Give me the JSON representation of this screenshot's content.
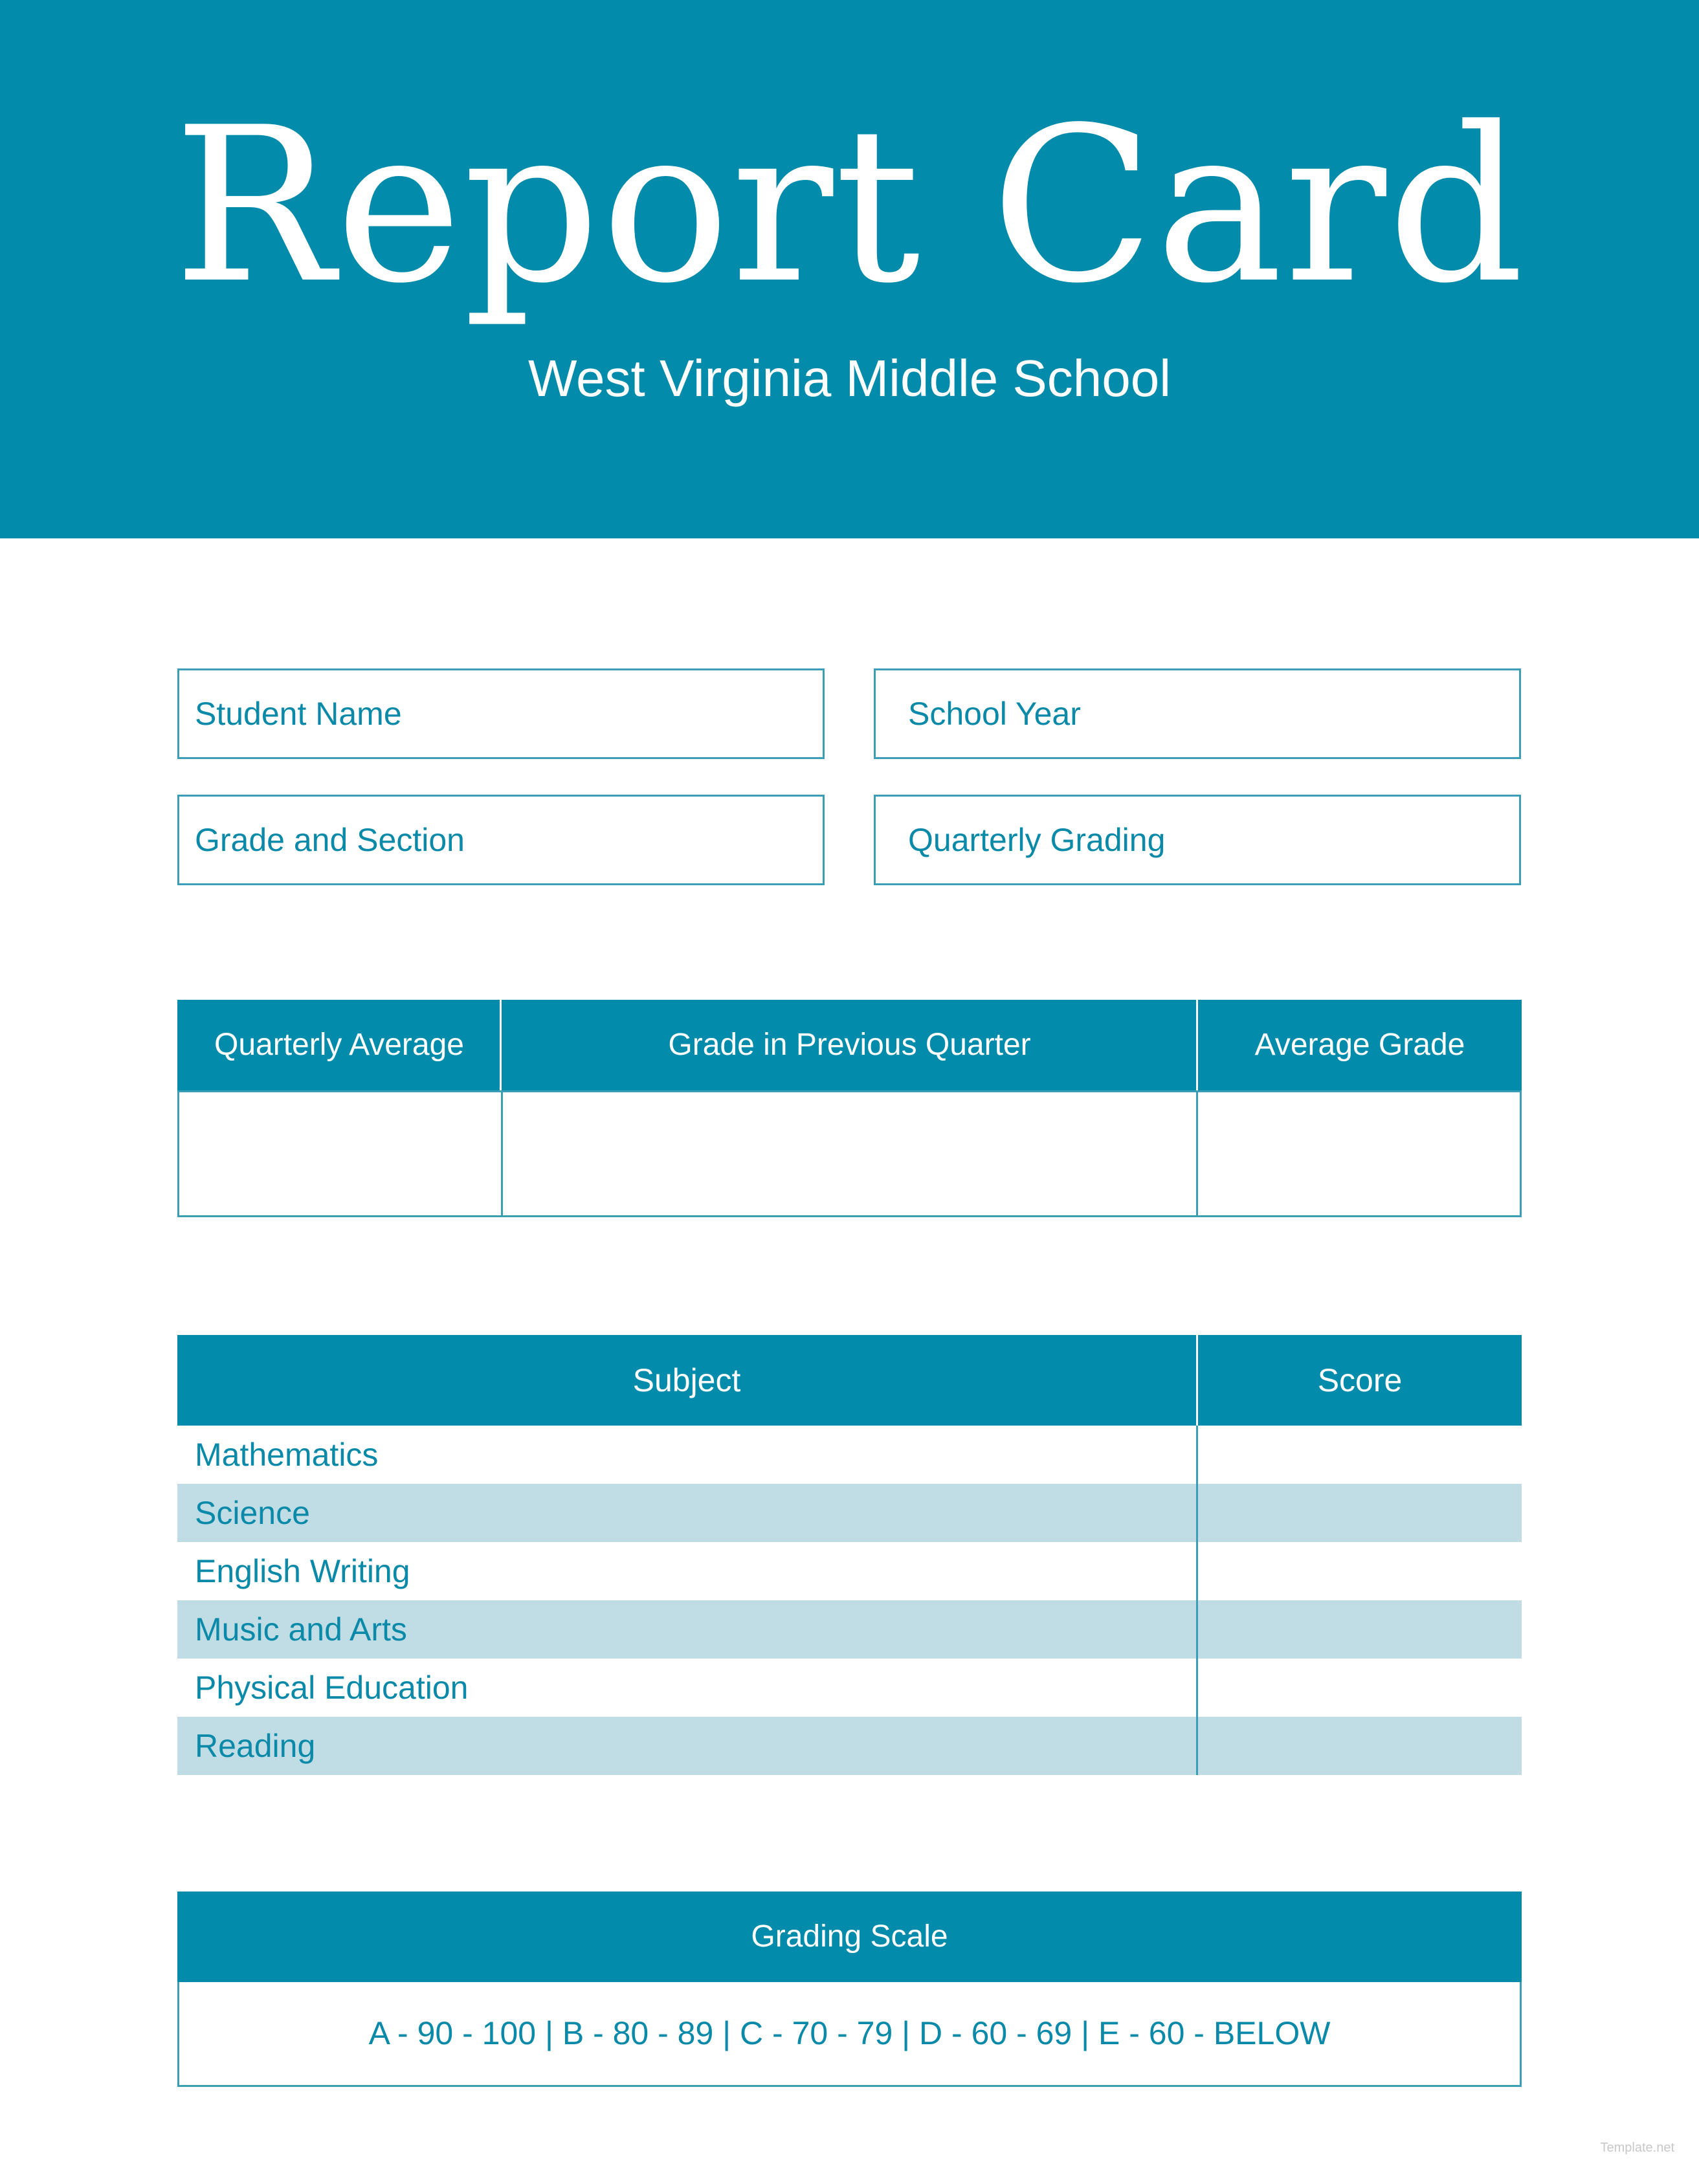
{
  "header": {
    "title": "Report Card",
    "subtitle": "West Virginia Middle School",
    "background_color": "#028baa"
  },
  "fields": {
    "student_name": "Student Name",
    "school_year": "School Year",
    "grade_and_section": "Grade and Section",
    "quarterly_grading": "Quarterly Grading"
  },
  "averages_table": {
    "headers": [
      "Quarterly Average",
      "Grade in Previous Quarter",
      "Average Grade"
    ],
    "values": [
      "",
      "",
      ""
    ]
  },
  "subjects_table": {
    "headers": {
      "subject": "Subject",
      "score": "Score"
    },
    "rows": [
      {
        "subject": "Mathematics",
        "score": ""
      },
      {
        "subject": "Science",
        "score": ""
      },
      {
        "subject": "English Writing",
        "score": ""
      },
      {
        "subject": "Music and Arts",
        "score": ""
      },
      {
        "subject": "Physical Education",
        "score": ""
      },
      {
        "subject": "Reading",
        "score": ""
      }
    ],
    "alt_row_color": "#c0dce5"
  },
  "grading_scale": {
    "title": "Grading Scale",
    "text": "A - 90 - 100 | B - 80 - 89 | C - 70 - 79 | D - 60 - 69 | E - 60 - BELOW"
  },
  "watermark": "Template.net",
  "colors": {
    "accent": "#028baa",
    "text": "#0a8aa8",
    "border": "#3b9db6"
  }
}
